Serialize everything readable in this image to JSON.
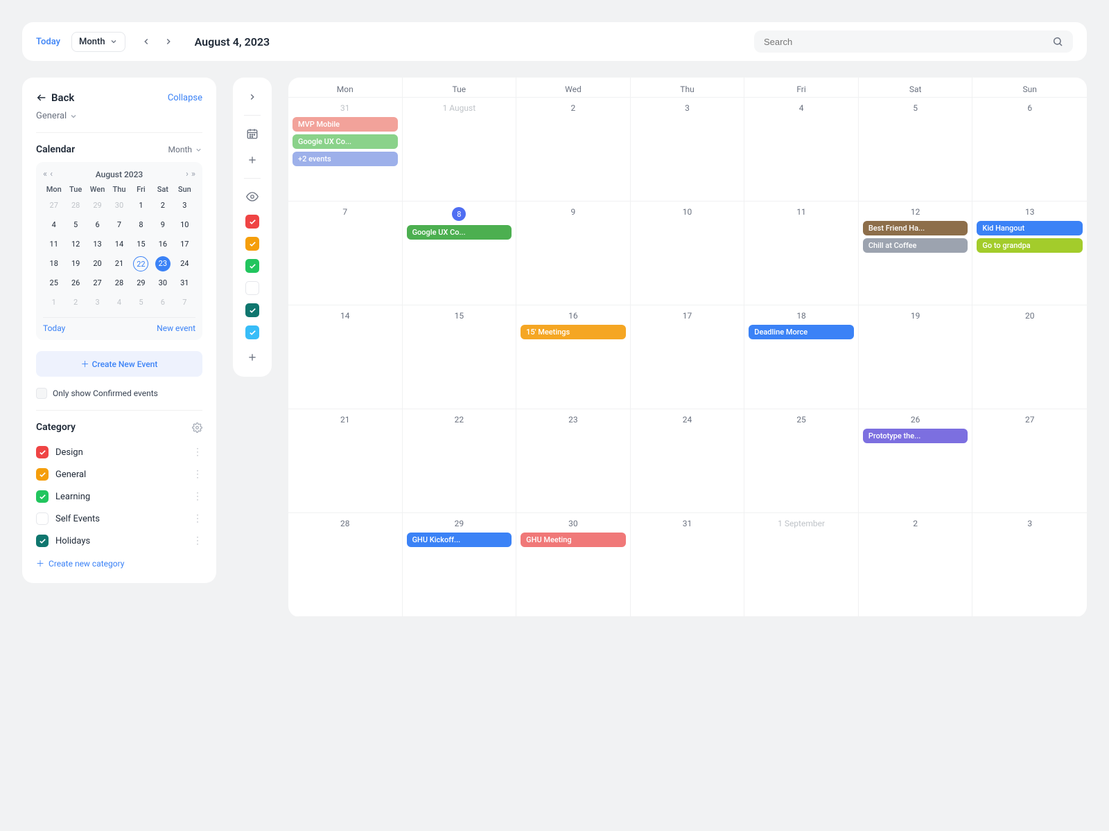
{
  "topbar": {
    "today_label": "Today",
    "view_label": "Month",
    "date_heading": "August 4, 2023",
    "search_placeholder": "Search"
  },
  "sidebar": {
    "back_label": "Back",
    "collapse_label": "Collapse",
    "general_label": "General",
    "calendar_section_title": "Calendar",
    "calendar_view_label": "Month",
    "mini_calendar": {
      "title": "August  2023",
      "day_headers": [
        "Mon",
        "Tue",
        "Wen",
        "Thu",
        "Fri",
        "Sat",
        "Sun"
      ],
      "weeks": [
        [
          {
            "d": "27",
            "dim": true
          },
          {
            "d": "28",
            "dim": true
          },
          {
            "d": "29",
            "dim": true
          },
          {
            "d": "30",
            "dim": true
          },
          {
            "d": "1"
          },
          {
            "d": "2"
          },
          {
            "d": "3"
          }
        ],
        [
          {
            "d": "4"
          },
          {
            "d": "5"
          },
          {
            "d": "6"
          },
          {
            "d": "7"
          },
          {
            "d": "8"
          },
          {
            "d": "9"
          },
          {
            "d": "10"
          }
        ],
        [
          {
            "d": "11"
          },
          {
            "d": "12"
          },
          {
            "d": "13"
          },
          {
            "d": "14"
          },
          {
            "d": "15"
          },
          {
            "d": "16"
          },
          {
            "d": "17"
          }
        ],
        [
          {
            "d": "18"
          },
          {
            "d": "19"
          },
          {
            "d": "20"
          },
          {
            "d": "21"
          },
          {
            "d": "22",
            "outlined": true
          },
          {
            "d": "23",
            "solid": true
          },
          {
            "d": "24"
          }
        ],
        [
          {
            "d": "25"
          },
          {
            "d": "26"
          },
          {
            "d": "27"
          },
          {
            "d": "28"
          },
          {
            "d": "29"
          },
          {
            "d": "30"
          },
          {
            "d": "31"
          }
        ],
        [
          {
            "d": "1",
            "dim": true
          },
          {
            "d": "2",
            "dim": true
          },
          {
            "d": "3",
            "dim": true
          },
          {
            "d": "4",
            "dim": true
          },
          {
            "d": "5",
            "dim": true
          },
          {
            "d": "6",
            "dim": true
          },
          {
            "d": "7",
            "dim": true
          }
        ]
      ],
      "today_label": "Today",
      "new_event_label": "New event"
    },
    "create_event_label": "Create New Event",
    "filter_label": "Only show Confirmed events",
    "category_title": "Category",
    "categories": [
      {
        "label": "Design",
        "color": "#ef4444",
        "checked": true
      },
      {
        "label": "General",
        "color": "#f59e0b",
        "checked": true
      },
      {
        "label": "Learning",
        "color": "#22c55e",
        "checked": true
      },
      {
        "label": "Self Events",
        "color": "",
        "checked": false
      },
      {
        "label": "Holidays",
        "color": "#0f766e",
        "checked": true
      }
    ],
    "create_category_label": "Create new category"
  },
  "vtoolbar": {
    "checkboxes": [
      {
        "color": "#ef4444",
        "checked": true
      },
      {
        "color": "#f59e0b",
        "checked": true
      },
      {
        "color": "#22c55e",
        "checked": true
      },
      {
        "color": "",
        "checked": false
      },
      {
        "color": "#0f766e",
        "checked": true
      },
      {
        "color": "#38bdf8",
        "checked": true
      }
    ]
  },
  "calendar": {
    "day_headers": [
      "Mon",
      "Tue",
      "Wed",
      "Thu",
      "Fri",
      "Sat",
      "Sun"
    ],
    "weeks": [
      [
        {
          "date": "31",
          "dim": true,
          "events": [
            {
              "label": "MVP Mobile",
              "color": "#f2a29a"
            },
            {
              "label": "Google UX Co...",
              "color": "#8ad28a"
            },
            {
              "label": "+2 events",
              "color": "#9db0ea"
            }
          ]
        },
        {
          "date": "1 August",
          "dim": true,
          "events": []
        },
        {
          "date": "2",
          "events": []
        },
        {
          "date": "3",
          "events": []
        },
        {
          "date": "4",
          "events": []
        },
        {
          "date": "5",
          "events": []
        },
        {
          "date": "6",
          "events": []
        }
      ],
      [
        {
          "date": "7",
          "events": []
        },
        {
          "date": "8",
          "badge": true,
          "events": [
            {
              "label": "Google UX Co...",
              "color": "#4caf50"
            }
          ]
        },
        {
          "date": "9",
          "events": []
        },
        {
          "date": "10",
          "events": []
        },
        {
          "date": "11",
          "events": []
        },
        {
          "date": "12",
          "events": [
            {
              "label": "Best Friend Ha...",
              "color": "#8d6e4a"
            },
            {
              "label": "Chill at Coffee",
              "color": "#9ca3af"
            }
          ]
        },
        {
          "date": "13",
          "events": [
            {
              "label": "Kid Hangout",
              "color": "#3b82f6"
            },
            {
              "label": "Go to grandpa",
              "color": "#a3cc2b"
            }
          ]
        }
      ],
      [
        {
          "date": "14",
          "events": []
        },
        {
          "date": "15",
          "events": []
        },
        {
          "date": "16",
          "events": [
            {
              "label": "15' Meetings",
              "color": "#f5a623"
            }
          ]
        },
        {
          "date": "17",
          "events": []
        },
        {
          "date": "18",
          "events": [
            {
              "label": "Deadline Morce",
              "color": "#3b82f6"
            }
          ]
        },
        {
          "date": "19",
          "events": []
        },
        {
          "date": "20",
          "events": []
        }
      ],
      [
        {
          "date": "21",
          "events": []
        },
        {
          "date": "22",
          "events": []
        },
        {
          "date": "23",
          "events": []
        },
        {
          "date": "24",
          "events": []
        },
        {
          "date": "25",
          "events": []
        },
        {
          "date": "26",
          "events": [
            {
              "label": "Prototype the...",
              "color": "#7c6fe0"
            }
          ]
        },
        {
          "date": "27",
          "events": []
        }
      ],
      [
        {
          "date": "28",
          "events": []
        },
        {
          "date": "29",
          "events": [
            {
              "label": "GHU Kickoff...",
              "color": "#3b82f6"
            }
          ]
        },
        {
          "date": "30",
          "events": [
            {
              "label": "GHU Meeting",
              "color": "#f07878"
            }
          ]
        },
        {
          "date": "31",
          "events": []
        },
        {
          "date": "1 September",
          "dim": true,
          "events": []
        },
        {
          "date": "2",
          "events": []
        },
        {
          "date": "3",
          "events": []
        }
      ]
    ]
  }
}
